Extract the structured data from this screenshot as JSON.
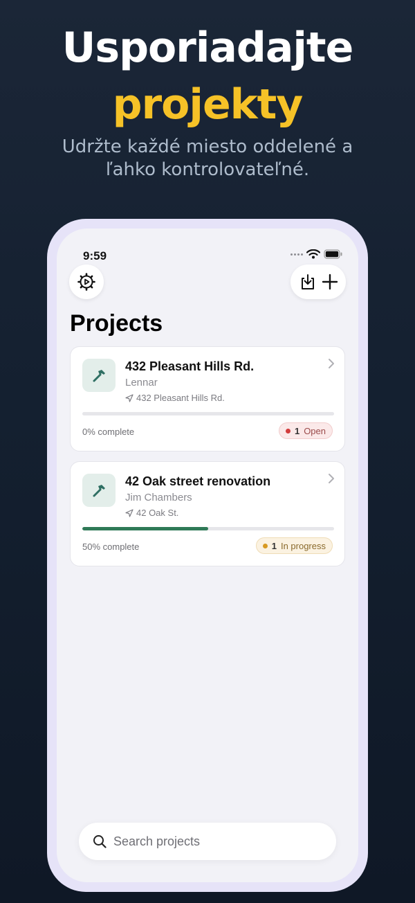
{
  "hero": {
    "title_line1": "Usporiadajte",
    "title_line2": "projekty",
    "subtitle": "Udržte každé miesto oddelené a ľahko kontrolovateľné."
  },
  "status_bar": {
    "time": "9:59"
  },
  "header": {
    "title": "Projects",
    "icons": [
      "settings-gear-icon",
      "import-icon",
      "plus-icon"
    ]
  },
  "projects": [
    {
      "name": "432 Pleasant Hills Rd.",
      "client": "Lennar",
      "address": "432 Pleasant Hills Rd.",
      "progress": 0,
      "progress_label": "0% complete",
      "badge_count": "1",
      "badge_label": "Open",
      "badge_color": "#d23c3c"
    },
    {
      "name": "42 Oak street renovation",
      "client": "Jim Chambers",
      "address": "42 Oak St.",
      "progress": 50,
      "progress_label": "50% complete",
      "badge_count": "1",
      "badge_label": "In progress",
      "badge_color": "#d89a22"
    }
  ],
  "search": {
    "placeholder": "Search projects"
  },
  "colors": {
    "accent": "#f6c227",
    "progress_fill": "#2f7a57",
    "icon_tint": "#2f6f63"
  }
}
